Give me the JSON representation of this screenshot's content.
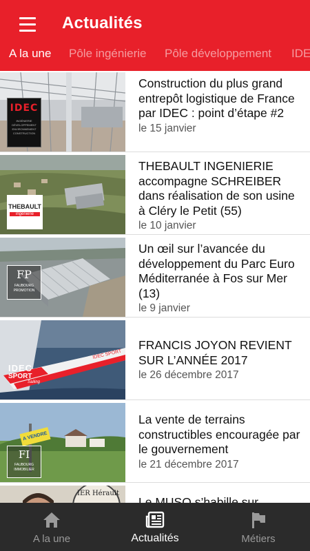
{
  "header": {
    "title": "Actualités",
    "menu_icon": "hamburger-menu-icon",
    "background_color": "#e8202a"
  },
  "tabs": [
    {
      "label": "A la une",
      "active": true
    },
    {
      "label": "Pôle ingénierie",
      "active": false
    },
    {
      "label": "Pôle développement",
      "active": false
    },
    {
      "label": "IDEC",
      "active": false
    }
  ],
  "articles": [
    {
      "headline": "Construction du plus grand entrepôt logistique de France par IDEC : point d’étape #2",
      "date": "le 15 janvier",
      "logo": {
        "lines": [
          "IDEC",
          "INGÉNIERIE",
          "DÉVELOPPEMENT",
          "ENVIRONNEMENT",
          "CONSTRUCTION"
        ]
      }
    },
    {
      "headline": "THEBAULT INGENIERIE accompagne SCHREIBER dans réalisation de son usine à Cléry le Petit (55)",
      "date": "le 10 janvier",
      "logo": {
        "lines": [
          "THEBAULT",
          "ingénierie"
        ]
      }
    },
    {
      "headline": "Un œil sur l’avancée du développement du Parc Euro Méditerranée à Fos sur Mer (13)",
      "date": "le 9 janvier",
      "logo": {
        "lines": [
          "FP",
          "FAUBOURG",
          "PROMOTION"
        ]
      }
    },
    {
      "headline": "FRANCIS JOYON REVIENT SUR L’ANNÉE 2017",
      "date": "le 26 décembre 2017",
      "logo": {
        "lines": [
          "IDEC",
          "SPORT",
          "Sailing"
        ]
      }
    },
    {
      "headline": "La vente de terrains constructibles encouragée par le gouvernement",
      "date": "le 21 décembre 2017",
      "logo": {
        "lines": [
          "FI",
          "FAUBOURG",
          "IMMOBILIER"
        ]
      },
      "sign": "A VENDRE"
    },
    {
      "headline": "Le MUSO s’habille sur",
      "date": "",
      "logo": {
        "lines": [
          "IER Hérault"
        ]
      }
    }
  ],
  "bottom_nav": [
    {
      "label": "A la une",
      "icon": "home-icon",
      "active": false
    },
    {
      "label": "Actualités",
      "icon": "newspaper-icon",
      "active": true
    },
    {
      "label": "Métiers",
      "icon": "flag-icon",
      "active": false
    }
  ]
}
